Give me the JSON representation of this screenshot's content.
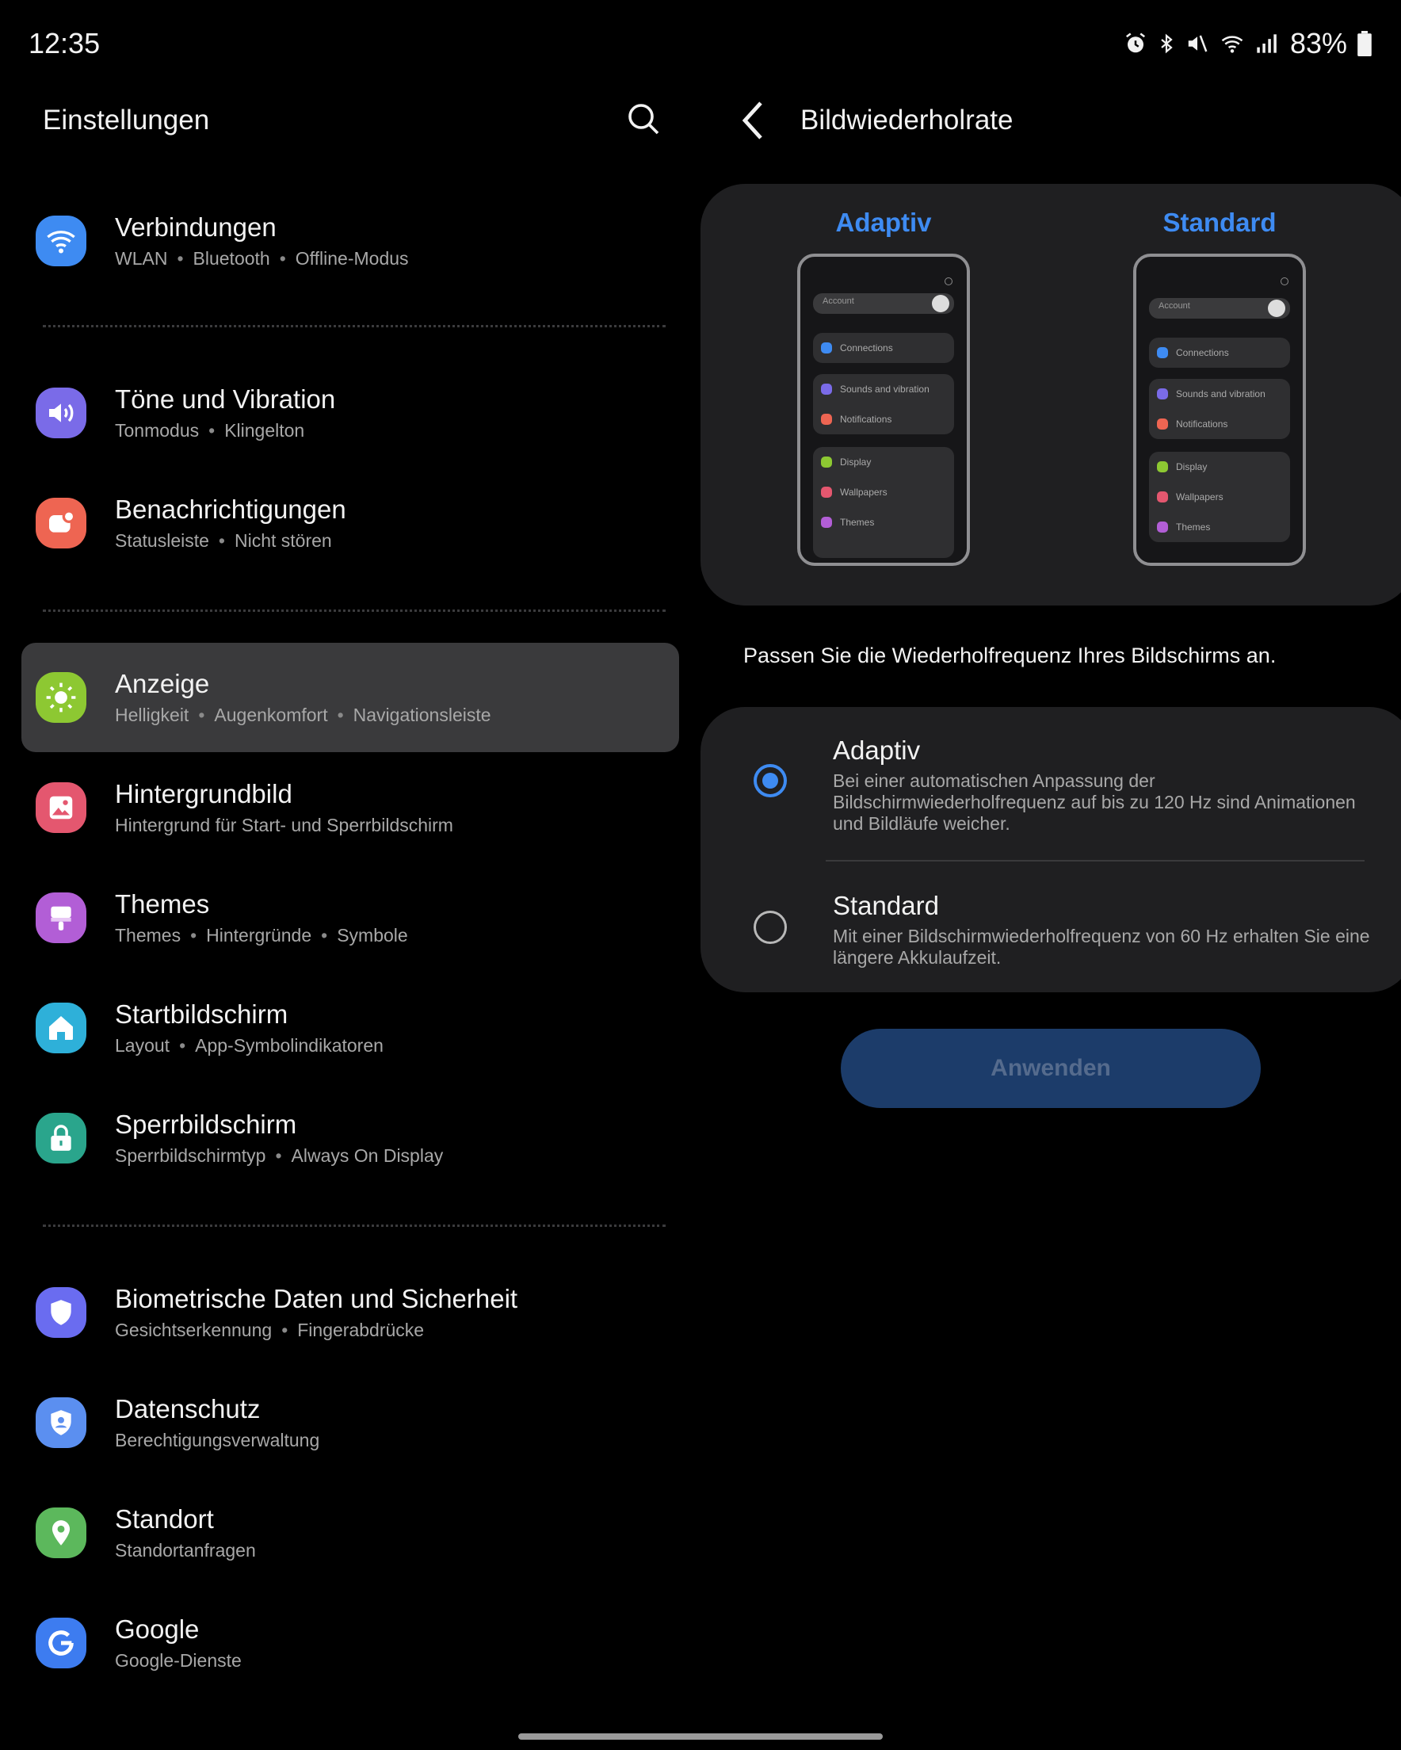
{
  "status_bar": {
    "time": "12:35",
    "battery": "83%",
    "icons": [
      "alarm-icon",
      "bluetooth-icon",
      "mute-icon",
      "wifi-icon",
      "signal-icon",
      "battery-icon"
    ]
  },
  "left_panel": {
    "title": "Einstellungen",
    "items": [
      {
        "title": "Verbindungen",
        "subs": [
          "WLAN",
          "Bluetooth",
          "Offline-Modus"
        ],
        "icon": "wifi-icon",
        "color": "#3e8bf2"
      },
      {
        "title": "Töne und Vibration",
        "subs": [
          "Tonmodus",
          "Klingelton"
        ],
        "icon": "speaker-icon",
        "color": "#7a6be8"
      },
      {
        "title": "Benachrichtigungen",
        "subs": [
          "Statusleiste",
          "Nicht stören"
        ],
        "icon": "notification-icon",
        "color": "#ee6552"
      },
      {
        "title": "Anzeige",
        "subs": [
          "Helligkeit",
          "Augenkomfort",
          "Navigationsleiste"
        ],
        "icon": "sun-icon",
        "color": "#8dc832",
        "active": true
      },
      {
        "title": "Hintergrundbild",
        "subs": [
          "Hintergrund für Start- und Sperrbildschirm"
        ],
        "icon": "image-icon",
        "color": "#e4576f"
      },
      {
        "title": "Themes",
        "subs": [
          "Themes",
          "Hintergründe",
          "Symbole"
        ],
        "icon": "brush-icon",
        "color": "#b25ed6"
      },
      {
        "title": "Startbildschirm",
        "subs": [
          "Layout",
          "App-Symbolindikatoren"
        ],
        "icon": "home-icon",
        "color": "#2eb0d9"
      },
      {
        "title": "Sperrbildschirm",
        "subs": [
          "Sperrbildschirmtyp",
          "Always On Display"
        ],
        "icon": "lock-icon",
        "color": "#2aa58c"
      },
      {
        "title": "Biometrische Daten und Sicherheit",
        "subs": [
          "Gesichtserkennung",
          "Fingerabdrücke"
        ],
        "icon": "shield-icon",
        "color": "#6a6cf0"
      },
      {
        "title": "Datenschutz",
        "subs": [
          "Berechtigungsverwaltung"
        ],
        "icon": "privacy-icon",
        "color": "#5b8ff0"
      },
      {
        "title": "Standort",
        "subs": [
          "Standortanfragen"
        ],
        "icon": "location-icon",
        "color": "#5cb85c"
      },
      {
        "title": "Google",
        "subs": [
          "Google-Dienste"
        ],
        "icon": "google-icon",
        "color": "#3d7cf0"
      }
    ]
  },
  "right_panel": {
    "title": "Bildwiederholrate",
    "preview": {
      "left_label": "Adaptiv",
      "right_label": "Standard",
      "phone_account": "Account",
      "phone_rows": [
        {
          "label": "Connections",
          "color": "#3e8bf2"
        },
        {
          "label": "Sounds and vibration",
          "color": "#7a6be8"
        },
        {
          "label": "Notifications",
          "color": "#ee6552"
        },
        {
          "label": "Display",
          "color": "#8dc832"
        },
        {
          "label": "Wallpapers",
          "color": "#e4576f"
        },
        {
          "label": "Themes",
          "color": "#b25ed6"
        }
      ]
    },
    "description": "Passen Sie die Wiederholfrequenz Ihres Bildschirms an.",
    "options": [
      {
        "title": "Adaptiv",
        "desc": "Bei einer automatischen Anpassung der Bildschirmwiederholfrequenz auf bis zu 120 Hz sind Animationen und Bildläufe weicher.",
        "selected": true
      },
      {
        "title": "Standard",
        "desc": "Mit einer Bildschirmwiederholfrequenz von 60 Hz erhalten Sie eine längere Akkulaufzeit.",
        "selected": false
      }
    ],
    "apply_label": "Anwenden"
  },
  "colors": {
    "accent": "#3e8bf2",
    "background": "#000000",
    "card": "#1f1f21",
    "active_item": "#3a3a3c"
  }
}
